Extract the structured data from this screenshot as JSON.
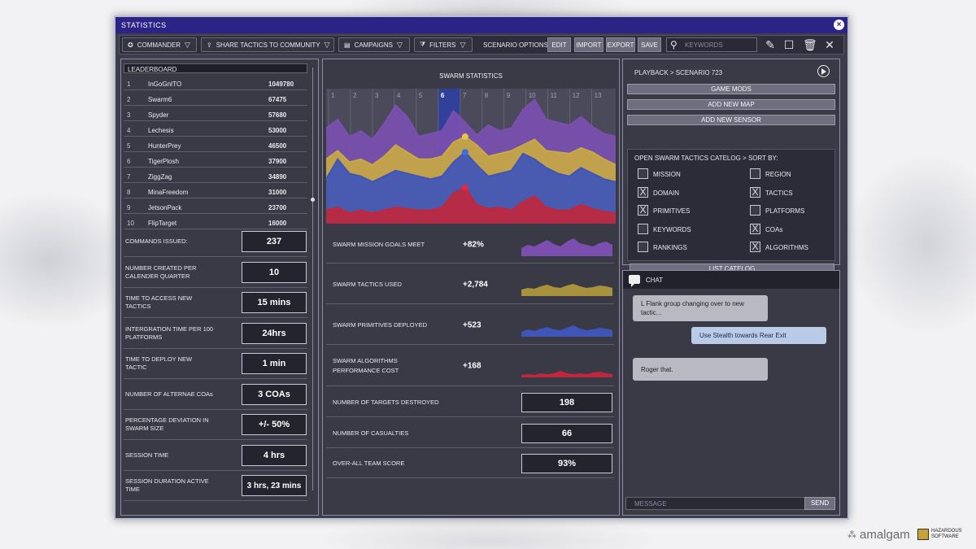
{
  "window": {
    "title": "STATISTICS"
  },
  "toolbar": {
    "commander": "COMMANDER",
    "share": "SHARE TACTICS TO COMMUNITY",
    "campaigns": "CAMPAIGNS",
    "filters": "FILTERS",
    "scenario_options": "SCENARIO OPTIONS:",
    "edit": "EDIT",
    "import": "IMPORT",
    "export": "EXPORT",
    "save": "SAVE",
    "search_placeholder": "KEYWORDS"
  },
  "leaderboard": {
    "title": "LEADERBOARD",
    "rows": [
      {
        "rank": "1",
        "name": "InGoGnITO",
        "score": "1049780"
      },
      {
        "rank": "2",
        "name": "Swarm6",
        "score": "67475"
      },
      {
        "rank": "3",
        "name": "Spyder",
        "score": "57680"
      },
      {
        "rank": "4",
        "name": "Lechesis",
        "score": "53000"
      },
      {
        "rank": "5",
        "name": "HunterPrey",
        "score": "46500"
      },
      {
        "rank": "6",
        "name": "TigerPlosh",
        "score": "37900"
      },
      {
        "rank": "7",
        "name": "ZiggZag",
        "score": "34890"
      },
      {
        "rank": "8",
        "name": "MinaFreedom",
        "score": "31000"
      },
      {
        "rank": "9",
        "name": "JetsonPack",
        "score": "23700"
      },
      {
        "rank": "10",
        "name": "FlipTarget",
        "score": "16000"
      }
    ]
  },
  "stats": [
    {
      "label": "COMMANDS ISSUED:",
      "value": "237"
    },
    {
      "label": "NUMBER CREATED PER CALENDER QUARTER",
      "value": "10"
    },
    {
      "label": "TIME TO ACCESS NEW TACTICS",
      "value": "15 mins"
    },
    {
      "label": "INTERGRATION TIME PER 100 PLATFORMS",
      "value": "24hrs"
    },
    {
      "label": "TIME TO DEPLOY NEW TACTIC",
      "value": "1 min"
    },
    {
      "label": "NUMBER OF ALTERNAE COAs",
      "value": "3 COAs"
    },
    {
      "label": "PERCENTAGE DEVIATION IN SWARM SIZE",
      "value": "+/- 50%"
    },
    {
      "label": "SESSION TIME",
      "value": "4 hrs"
    },
    {
      "label": "SESSION DURATION ACTIVE TIME",
      "value": "3 hrs, 23 mins"
    }
  ],
  "swarm": {
    "title": "SWARM STATISTICS",
    "metrics": [
      {
        "label": "SWARM MISSION GOALS  MEET",
        "value": "+82%",
        "color": "#7a4fb0"
      },
      {
        "label": "SWARM TACTICS USED",
        "value": "+2,784",
        "color": "#a8923c"
      },
      {
        "label": "SWARM PRIMITIVES DEPLOYED",
        "value": "+523",
        "color": "#3f55b8"
      },
      {
        "label": "SWARM ALGORITHMS PERFORMANCE COST",
        "value": "+168",
        "color": "#c0273c"
      }
    ],
    "totals": [
      {
        "label": "NUMBER OF TARGETS DESTROYED",
        "value": "198"
      },
      {
        "label": "NUMBER OF CASUALTIES",
        "value": "66"
      },
      {
        "label": "OVER-ALL TEAM SCORE",
        "value": "93%"
      }
    ]
  },
  "chart_data": {
    "type": "area",
    "x": [
      "1",
      "2",
      "3",
      "4",
      "5",
      "6",
      "7",
      "8",
      "9",
      "10",
      "11",
      "12",
      "13"
    ],
    "highlight": "6",
    "series": [
      {
        "color": "#7a4fb0",
        "values": [
          72,
          78,
          66,
          70,
          64,
          75,
          88,
          80,
          66,
          68,
          70,
          84,
          76,
          67,
          74,
          70,
          72,
          85,
          92,
          78,
          76,
          74,
          80,
          73,
          68,
          66
        ]
      },
      {
        "color": "#c8a843",
        "values": [
          50,
          56,
          48,
          50,
          46,
          52,
          60,
          55,
          50,
          50,
          52,
          62,
          66,
          60,
          52,
          54,
          56,
          60,
          64,
          56,
          55,
          54,
          58,
          55,
          50,
          46
        ]
      },
      {
        "color": "#3f55b8",
        "values": [
          36,
          50,
          40,
          38,
          34,
          38,
          42,
          40,
          38,
          36,
          38,
          48,
          55,
          46,
          38,
          40,
          42,
          54,
          50,
          44,
          40,
          38,
          44,
          40,
          36,
          34
        ]
      },
      {
        "color": "#c0273c",
        "values": [
          14,
          16,
          12,
          14,
          12,
          14,
          16,
          15,
          14,
          14,
          16,
          26,
          30,
          18,
          15,
          16,
          14,
          20,
          24,
          16,
          14,
          14,
          18,
          15,
          13,
          12
        ]
      }
    ],
    "ylim": [
      0,
      100
    ]
  },
  "right": {
    "playback": "PLAYBACK > SCENARIO 723",
    "buttons": [
      "GAME MODS",
      "ADD NEW MAP",
      "ADD NEW SENSOR"
    ],
    "catalog_title": "OPEN SWARM TACTICS CATELOG > SORT BY:",
    "options": [
      {
        "label": "MISSION",
        "checked": false
      },
      {
        "label": "REGION",
        "checked": false
      },
      {
        "label": "DOMAIN",
        "checked": true
      },
      {
        "label": "TACTICS",
        "checked": true
      },
      {
        "label": "PRIMITIVES",
        "checked": true
      },
      {
        "label": "PLATFORMS",
        "checked": false
      },
      {
        "label": "KEYWORDS",
        "checked": false
      },
      {
        "label": "COAs",
        "checked": true
      },
      {
        "label": "RANKINGS",
        "checked": false
      },
      {
        "label": "ALGORITHMS",
        "checked": true
      }
    ],
    "list_catalog": "LIST CATELOG"
  },
  "chat": {
    "title": "CHAT",
    "messages": [
      {
        "text": "L Flank group changing over to new tactic...",
        "dir": "in"
      },
      {
        "text": "Use Stealth towards Rear Exit",
        "dir": "out"
      },
      {
        "text": "Roger that.",
        "dir": "in"
      }
    ],
    "placeholder": "MESSAGE",
    "send": "SEND"
  },
  "branding": {
    "amalgam": "amalgam",
    "hazardous_1": "HAZARDOUS",
    "hazardous_2": "SOFTWARE"
  }
}
